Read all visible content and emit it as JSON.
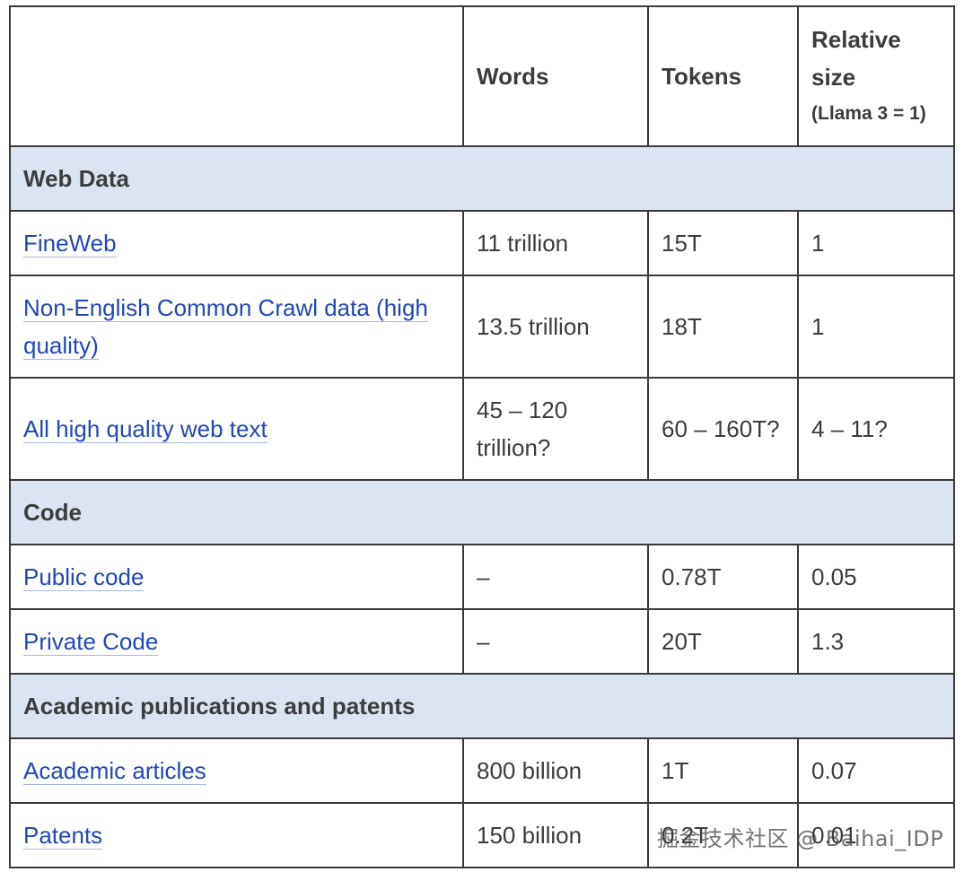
{
  "header": {
    "col1": "",
    "col2": "Words",
    "col3": "Tokens",
    "col4": "Relative size",
    "col4_note": "(Llama 3 = 1)"
  },
  "sections": [
    {
      "title": "Web Data",
      "rows": [
        {
          "name": "FineWeb",
          "words": "11 trillion",
          "tokens": "15T",
          "relative": "1"
        },
        {
          "name": "Non-English Common Crawl data (high quality)",
          "words": "13.5 trillion",
          "tokens": "18T",
          "relative": "1"
        },
        {
          "name": "All high quality web text",
          "words": "45 – 120 trillion?",
          "tokens": "60 – 160T?",
          "relative": "4 – 11?"
        }
      ]
    },
    {
      "title": "Code",
      "rows": [
        {
          "name": "Public code",
          "words": "–",
          "tokens": "0.78T",
          "relative": "0.05"
        },
        {
          "name": "Private Code",
          "words": "–",
          "tokens": "20T",
          "relative": "1.3"
        }
      ]
    },
    {
      "title": "Academic publications and patents",
      "rows": [
        {
          "name": "Academic articles",
          "words": "800 billion",
          "tokens": "1T",
          "relative": "0.07"
        },
        {
          "name": "Patents",
          "words": "150 billion",
          "tokens": "0.2T",
          "relative": "0.01"
        }
      ]
    }
  ],
  "watermark": "掘金技术社区 @ Baihai_IDP"
}
